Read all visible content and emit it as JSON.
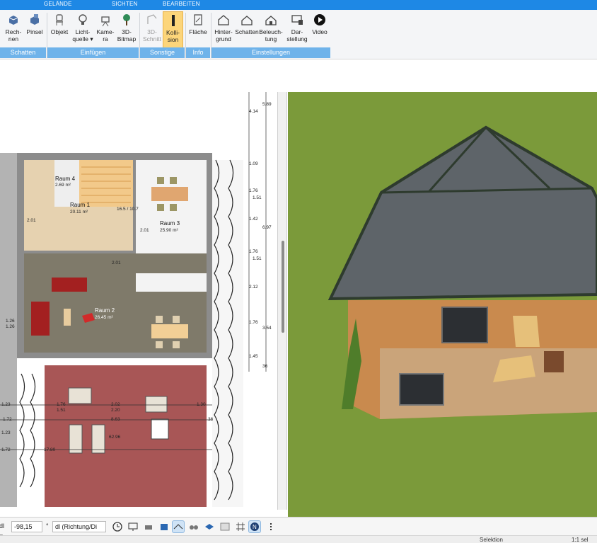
{
  "ribbon": {
    "tabs": [
      "GELÄNDE",
      "SICHTEN",
      "BEARBEITEN"
    ],
    "buttons": [
      {
        "label": "Rech-\nnen",
        "icon": "calculate-icon"
      },
      {
        "label": "Pinsel",
        "icon": "brush-icon"
      },
      {
        "label": "Objekt",
        "icon": "chair-icon"
      },
      {
        "label": "Licht-\nquelle ▾",
        "icon": "lightbulb-icon"
      },
      {
        "label": "Kame-\nra",
        "icon": "camera-icon"
      },
      {
        "label": "3D-\nBitmap",
        "icon": "tree-icon"
      },
      {
        "label": "3D-\nSchnitt",
        "icon": "section-icon"
      },
      {
        "label": "Kolli-\nsion",
        "icon": "collision-icon"
      },
      {
        "label": "Fläche",
        "icon": "area-icon"
      },
      {
        "label": "Hinter-\ngrund",
        "icon": "background-icon"
      },
      {
        "label": "Schatten",
        "icon": "shadow-icon"
      },
      {
        "label": "Beleuch-\ntung",
        "icon": "lighting-icon"
      },
      {
        "label": "Dar-\nstellung",
        "icon": "display-icon"
      },
      {
        "label": "Video",
        "icon": "video-play-icon"
      }
    ],
    "groups": [
      "Schatten",
      "Einfügen",
      "Sonstige",
      "Info",
      "Einstellungen"
    ]
  },
  "plan": {
    "rooms": [
      {
        "name": "Raum 4",
        "area": "2.69 m²"
      },
      {
        "name": "Raum 1",
        "area": "20.11 m²"
      },
      {
        "name": "Raum 3",
        "area": "25.90 m²"
      },
      {
        "name": "Raum 2",
        "area": "26.45 m²"
      }
    ],
    "dimensions_right": [
      "5.89",
      "4.14",
      "1.09",
      "1.76",
      "1.51",
      "1.42",
      "6.97",
      "1.76",
      "1.51",
      "2.12",
      "1.76",
      "3.54",
      "1.45",
      "36"
    ],
    "dimensions_bottom": [
      "1.76",
      "1.51",
      "2.02",
      "2.20",
      "1.30",
      "8.63",
      "1.72",
      "1.23",
      "1.23",
      "1.72",
      "36"
    ],
    "misc_labels": [
      "2.01",
      "2.01",
      "2.01",
      "1.26",
      "1.26",
      "62.96",
      "17.80",
      "16.5 / 10.7"
    ]
  },
  "bottom_bar": {
    "field_prefix": "dl =",
    "field_value": "-98,15",
    "field_unit": "°",
    "dropdown_value": "dl (Richtung/Di",
    "tool_icons": [
      "clock-icon",
      "monitor-icon",
      "print-icon",
      "paint-icon",
      "roof-icon",
      "binocular-icon",
      "layers-icon",
      "material-icon",
      "grid-icon",
      "north-icon",
      "more-icon"
    ]
  },
  "status": {
    "mode": "Selektion",
    "scale": "1:1 sel"
  },
  "colors": {
    "ribbon_blue": "#1e88e5",
    "group_blue": "#6fb3ea",
    "active_yellow": "#fcd57a",
    "grass": "#7b9a3a",
    "terrace_red": "#a85656",
    "floor_beige": "#e6d2b0",
    "roof_gray": "#6f7478"
  }
}
